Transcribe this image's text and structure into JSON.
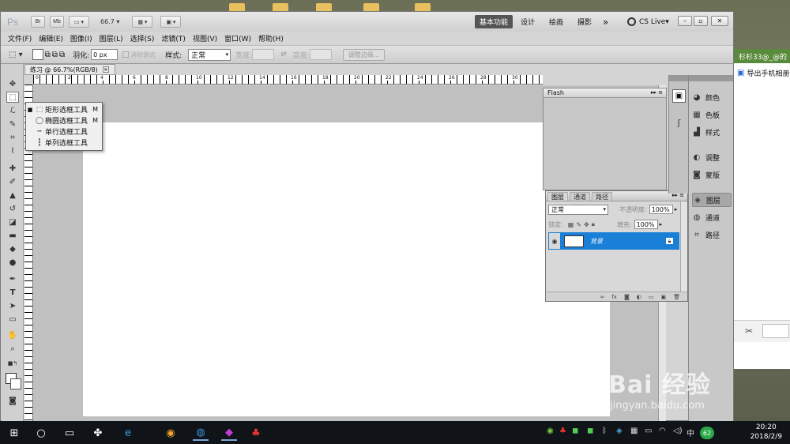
{
  "app": {
    "logo": "Ps",
    "bridge_label": "Br",
    "minibridge_label": "Mb",
    "zoom": "66.7",
    "workspaces": [
      "基本功能",
      "设计",
      "绘画",
      "摄影"
    ],
    "more": "»",
    "cs_live": "CS Live"
  },
  "menu": [
    "文件(F)",
    "编辑(E)",
    "图像(I)",
    "图层(L)",
    "选择(S)",
    "滤镜(T)",
    "视图(V)",
    "窗口(W)",
    "帮助(H)"
  ],
  "options": {
    "feather_label": "羽化:",
    "feather_value": "0 px",
    "antialias_label": "消除锯齿",
    "style_label": "样式:",
    "style_value": "正常",
    "width_label": "宽度:",
    "height_label": "高度:",
    "refine_edge": "调整边缘..."
  },
  "document": {
    "tab_title": "练习 @ 66.7%(RGB/8)",
    "ruler_numbers": [
      "0",
      "2",
      "4",
      "6",
      "8",
      "10",
      "12",
      "14",
      "16",
      "18",
      "20",
      "22",
      "24",
      "26",
      "28",
      "30"
    ]
  },
  "flyout": {
    "items": [
      {
        "label": "矩形选框工具",
        "key": "M",
        "icon": "rect-marquee-icon"
      },
      {
        "label": "椭圆选框工具",
        "key": "M",
        "icon": "ellipse-marquee-icon"
      },
      {
        "label": "单行选框工具",
        "key": "",
        "icon": "single-row-marquee-icon"
      },
      {
        "label": "单列选框工具",
        "key": "",
        "icon": "single-column-marquee-icon"
      }
    ]
  },
  "flash_panel": {
    "title": "Flash"
  },
  "layers_panel": {
    "tabs": [
      "图层",
      "通道",
      "路径"
    ],
    "blend_mode": "正常",
    "opacity_label": "不透明度:",
    "opacity_value": "100%",
    "lock_label": "锁定:",
    "fill_label": "填充:",
    "fill_value": "100%",
    "layer_name": "背景"
  },
  "dock": {
    "items": [
      "颜色",
      "色板",
      "样式",
      "调整",
      "蒙版",
      "图层",
      "通道",
      "路径"
    ]
  },
  "other_window": {
    "title": "杉杉33@_@的",
    "item": "导出手机相册"
  },
  "watermark": {
    "main": "Bai 经验",
    "sub": "jingyan.baidu.com"
  },
  "taskbar": {
    "time": "20:20",
    "date": "2018/2/9",
    "ime": "中",
    "badge": "62"
  }
}
